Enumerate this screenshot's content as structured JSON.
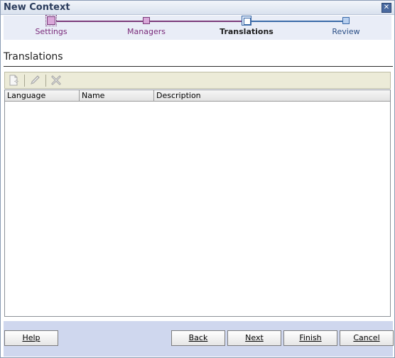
{
  "window": {
    "title": "New Context",
    "close_glyph": "✕"
  },
  "train": {
    "steps": [
      {
        "label": "Settings",
        "state": "done"
      },
      {
        "label": "Managers",
        "state": "done"
      },
      {
        "label": "Translations",
        "state": "current"
      },
      {
        "label": "Review",
        "state": "future"
      }
    ]
  },
  "section": {
    "title": "Translations"
  },
  "toolbar": {
    "buttons": [
      {
        "icon": "new-document-icon",
        "enabled": false
      },
      {
        "icon": "pencil-icon",
        "enabled": false
      },
      {
        "icon": "delete-x-icon",
        "enabled": false
      }
    ]
  },
  "table": {
    "columns": [
      "Language",
      "Name",
      "Description"
    ],
    "rows": []
  },
  "footer": {
    "help_label": "Help",
    "back_label": "Back",
    "next_label": "Next",
    "finish_label": "Finish",
    "cancel_label": "Cancel"
  },
  "colors": {
    "visited_step": "#7a2a7a",
    "future_step": "#2b4f86",
    "footer_bg": "#cfd7ee",
    "toolbar_bg": "#ecebd8"
  }
}
